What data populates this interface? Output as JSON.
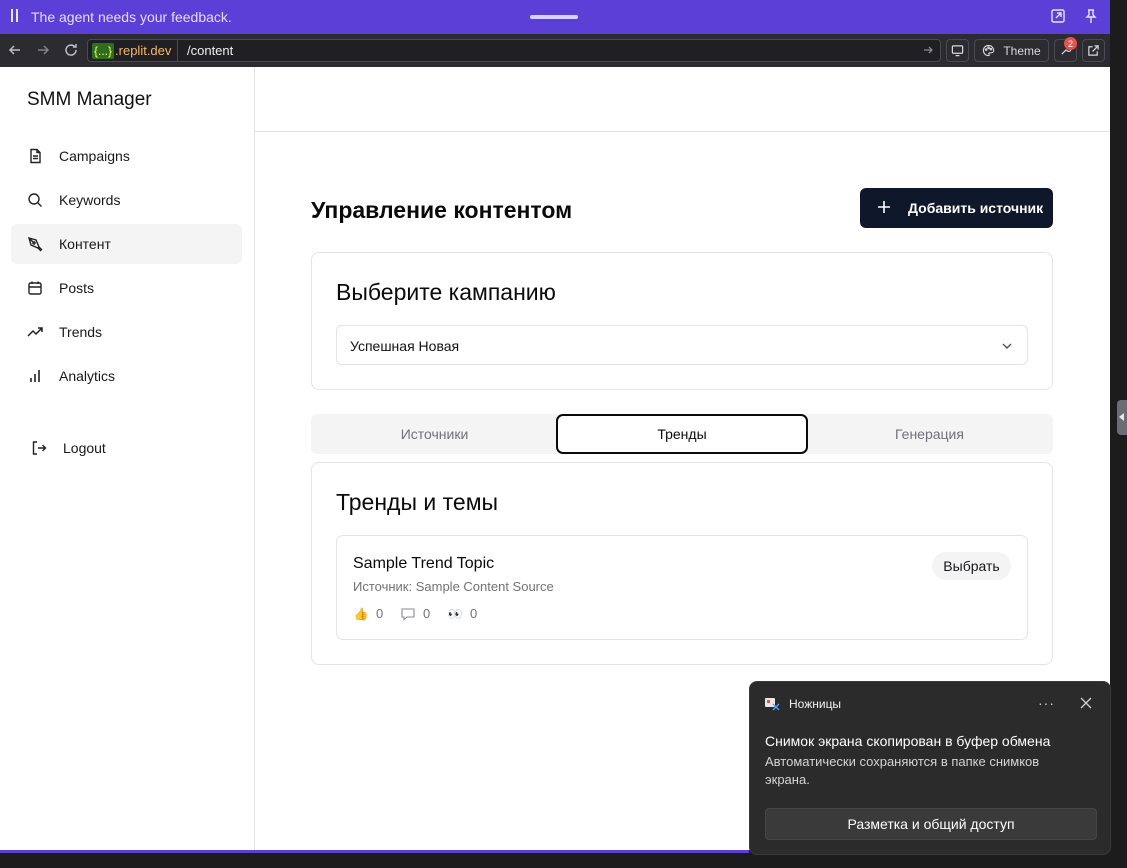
{
  "replit_bar": {
    "message": "The agent needs your feedback."
  },
  "browser": {
    "domain_prefix": "{...}",
    "domain_host": ".replit.dev",
    "path": "/content",
    "theme_label": "Theme",
    "notification_count": "2"
  },
  "sidebar": {
    "brand": "SMM Manager",
    "items": [
      {
        "label": "Campaigns",
        "icon": "document-icon",
        "active": false
      },
      {
        "label": "Keywords",
        "icon": "search-icon",
        "active": false
      },
      {
        "label": "Контент",
        "icon": "pen-tool-icon",
        "active": true
      },
      {
        "label": "Posts",
        "icon": "calendar-icon",
        "active": false
      },
      {
        "label": "Trends",
        "icon": "trending-up-icon",
        "active": false
      },
      {
        "label": "Analytics",
        "icon": "bar-chart-icon",
        "active": false
      }
    ],
    "logout_label": "Logout"
  },
  "main": {
    "title": "Управление контентом",
    "add_source_label": "Добавить источник",
    "campaign_card": {
      "title": "Выберите кампанию",
      "selected_campaign": "Успешная Новая"
    },
    "tabs": [
      {
        "label": "Источники",
        "active": false
      },
      {
        "label": "Тренды",
        "active": true
      },
      {
        "label": "Генерация",
        "active": false
      }
    ],
    "trends_card": {
      "title": "Тренды и темы",
      "trend": {
        "title": "Sample Trend Topic",
        "source": "Источник: Sample Content Source",
        "likes": "0",
        "comments": "0",
        "views": "0",
        "select_label": "Выбрать"
      }
    }
  },
  "toast": {
    "app_name": "Ножницы",
    "more": "···",
    "heading": "Снимок экрана скопирован в буфер обмена",
    "body": "Автоматически сохраняются в папке снимков экрана.",
    "action_label": "Разметка и общий доступ"
  }
}
